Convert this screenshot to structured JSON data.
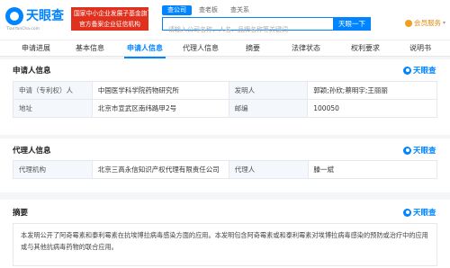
{
  "header": {
    "logo_text": "天眼查",
    "logo_sub": "TianYanCha.com",
    "promo_lines": [
      "国家中小企业发展子基金旗下",
      "官方备案企业征信机构"
    ],
    "search_tabs": [
      "查公司",
      "查老板",
      "查关系"
    ],
    "search_placeholder": "请输入公司名称、人名、品牌名称等关键词",
    "search_button": "天眼一下",
    "vip_label": "会员服务"
  },
  "tabs": [
    "申请进展",
    "基本信息",
    "申请人信息",
    "代理人信息",
    "摘要",
    "法律状态",
    "权利要求",
    "说明书"
  ],
  "active_tab": "申请人信息",
  "brand_label": "天眼查",
  "applicant": {
    "title": "申请人信息",
    "rows": [
      {
        "label1": "申请（专利权）人",
        "value1": "中国医学科学院药物研究所",
        "label2": "发明人",
        "value2": "郭颖;孙欣;蔡明宇;王丽丽"
      },
      {
        "label1": "地址",
        "value1": "北京市宣武区南纬路甲2号",
        "label2": "邮编",
        "value2": "100050"
      }
    ]
  },
  "agent": {
    "title": "代理人信息",
    "rows": [
      {
        "label1": "代理机构",
        "value1": "北京三高永信知识产权代理有限责任公司",
        "label2": "代理人",
        "value2": "滕一斌"
      }
    ]
  },
  "abstract": {
    "title": "摘要",
    "text": "本发明公开了阿奇霉素和泰利霉素在抗埃博拉病毒感染方面的应用。本发明包含阿奇霉素或和泰利霉素对埃博拉病毒感染的预防或治疗中的应用或与其他抗病毒药物的联合应用。"
  }
}
